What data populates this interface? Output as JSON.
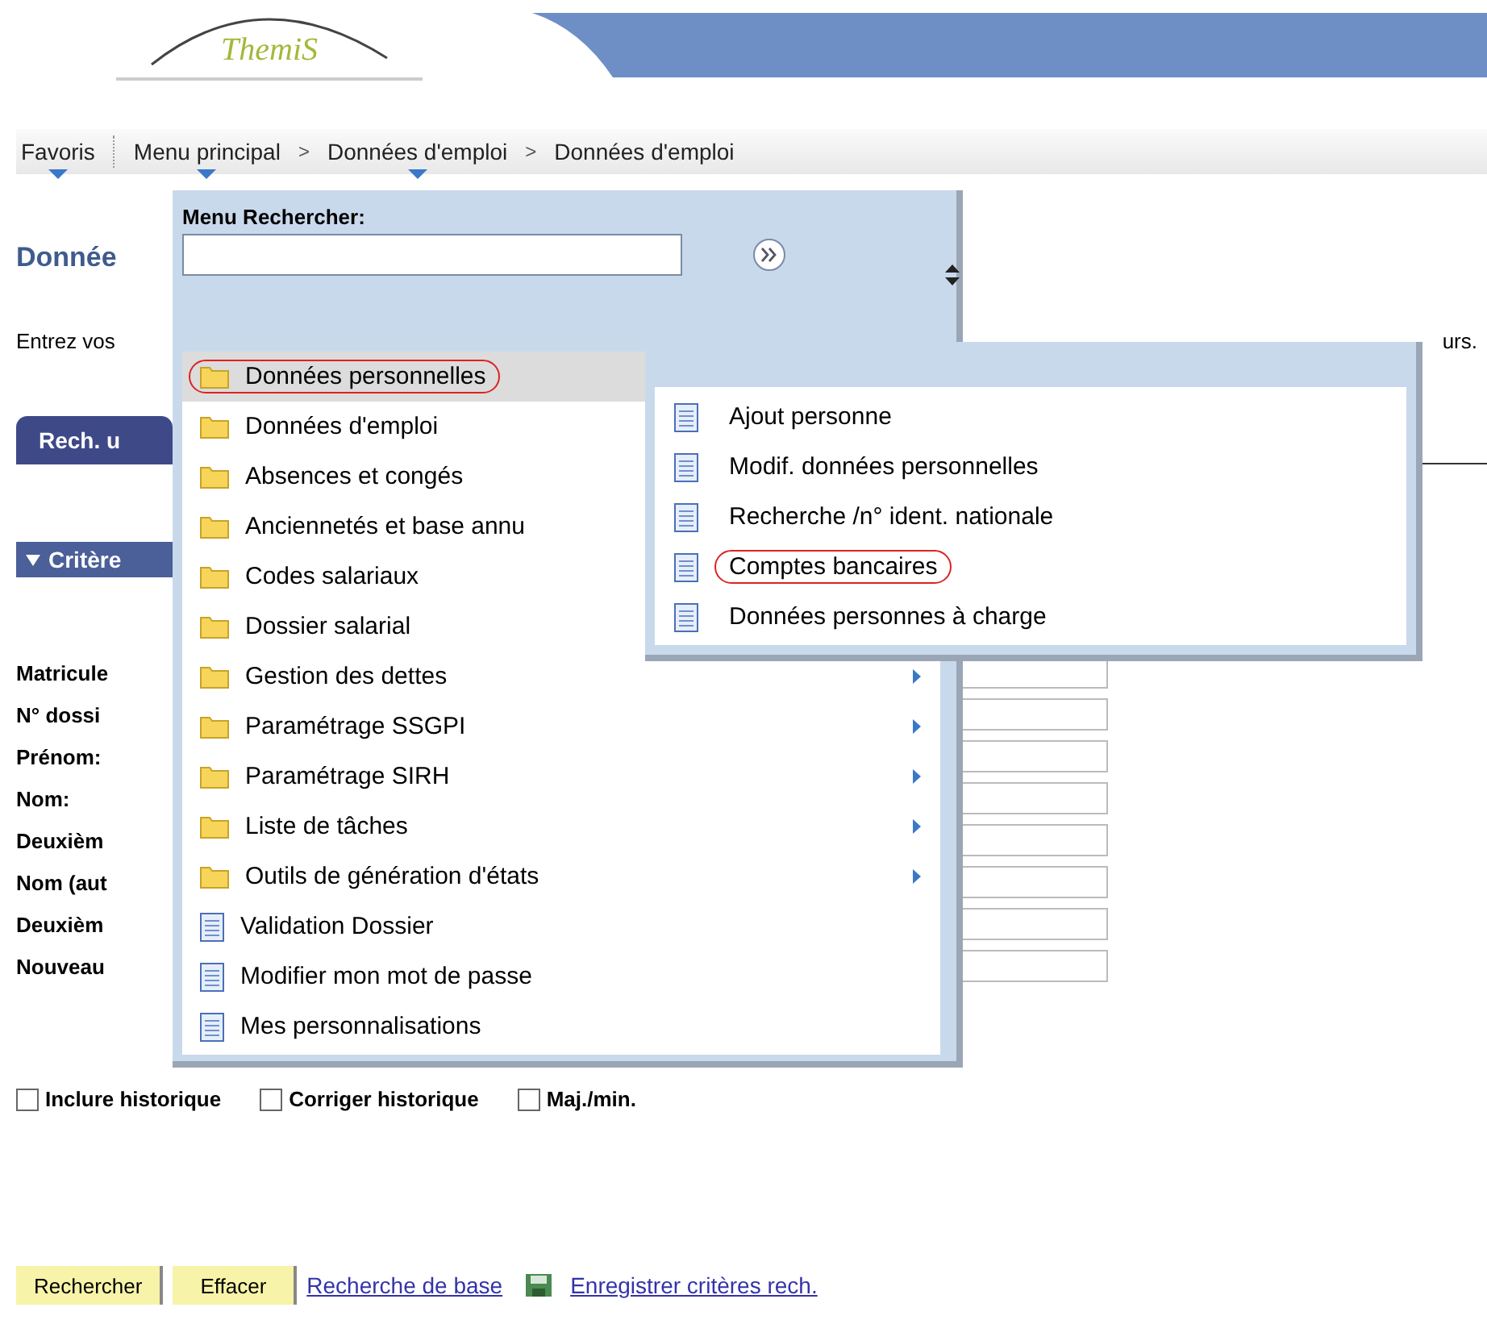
{
  "header": {
    "logo": "ThemiS"
  },
  "breadcrumb": [
    {
      "label": "Favoris",
      "dropdown": true
    },
    {
      "label": "Menu principal",
      "dropdown": true
    },
    {
      "label": "Données d'emploi",
      "separator_before": ">",
      "dropdown": true
    },
    {
      "label": "Données d'emploi",
      "separator_before": ">",
      "dropdown": false
    }
  ],
  "page_title": "Donnée",
  "instructions": "Entrez vos",
  "instructions_end": "urs.",
  "tab": {
    "label": "Rech. u",
    "selected": true
  },
  "section": {
    "label": "Critère",
    "expanded": true
  },
  "fields": [
    {
      "label": "Matricule"
    },
    {
      "label": "N° dossi"
    },
    {
      "label": "Prénom:"
    },
    {
      "label": "Nom:"
    },
    {
      "label": "Deuxièm"
    },
    {
      "label": "Nom (aut"
    },
    {
      "label": "Deuxièm"
    },
    {
      "label": "Nouveau"
    }
  ],
  "checkboxes": [
    {
      "label": "Inclure historique",
      "checked": false
    },
    {
      "label": "Corriger historique",
      "checked": false
    },
    {
      "label": "Maj./min.",
      "checked": false
    }
  ],
  "buttons": [
    "Rechercher",
    "Effacer"
  ],
  "links": [
    {
      "label": "Recherche de base",
      "icon": false
    },
    {
      "label": "Enregistrer critères rech.",
      "icon": true
    }
  ],
  "menu": {
    "search_label": "Menu Rechercher:",
    "items": [
      {
        "label": "Données personnelles",
        "kind": "folder",
        "selected": true,
        "circled": true,
        "submenu_arrow": false
      },
      {
        "label": "Données d'emploi",
        "kind": "folder",
        "selected": false,
        "circled": false,
        "submenu_arrow": false
      },
      {
        "label": "Absences et congés",
        "kind": "folder",
        "selected": false,
        "circled": false,
        "submenu_arrow": false
      },
      {
        "label": "Anciennetés et base annu",
        "kind": "folder",
        "selected": false,
        "circled": false,
        "submenu_arrow": false
      },
      {
        "label": "Codes salariaux",
        "kind": "folder",
        "selected": false,
        "circled": false,
        "submenu_arrow": false
      },
      {
        "label": "Dossier salarial",
        "kind": "folder",
        "selected": false,
        "circled": false,
        "submenu_arrow": false
      },
      {
        "label": "Gestion des dettes",
        "kind": "folder",
        "selected": false,
        "circled": false,
        "submenu_arrow": true
      },
      {
        "label": "Paramétrage SSGPI",
        "kind": "folder",
        "selected": false,
        "circled": false,
        "submenu_arrow": true
      },
      {
        "label": "Paramétrage SIRH",
        "kind": "folder",
        "selected": false,
        "circled": false,
        "submenu_arrow": true
      },
      {
        "label": "Liste de tâches",
        "kind": "folder",
        "selected": false,
        "circled": false,
        "submenu_arrow": true
      },
      {
        "label": "Outils de génération d'états",
        "kind": "folder",
        "selected": false,
        "circled": false,
        "submenu_arrow": true
      },
      {
        "label": "Validation Dossier",
        "kind": "page",
        "selected": false,
        "circled": false,
        "submenu_arrow": false
      },
      {
        "label": "Modifier mon mot de passe",
        "kind": "page",
        "selected": false,
        "circled": false,
        "submenu_arrow": false
      },
      {
        "label": "Mes personnalisations",
        "kind": "page",
        "selected": false,
        "circled": false,
        "submenu_arrow": false
      }
    ]
  },
  "submenu": {
    "items": [
      {
        "label": "Ajout personne",
        "kind": "page",
        "circled": false
      },
      {
        "label": "Modif. données personnelles",
        "kind": "page",
        "circled": false
      },
      {
        "label": "Recherche /n° ident. nationale",
        "kind": "page",
        "circled": false
      },
      {
        "label": "Comptes bancaires",
        "kind": "page",
        "circled": true
      },
      {
        "label": "Données personnes à charge",
        "kind": "page",
        "circled": false
      }
    ]
  }
}
